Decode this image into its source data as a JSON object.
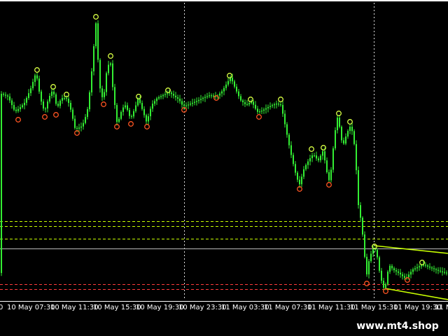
{
  "chart_data": {
    "type": "candlestick",
    "background_color": "#000000",
    "candle_color": "#33ee33",
    "fractal_up_color": "#d8ff44",
    "fractal_down_color": "#ff5522",
    "time_labels": [
      "10 May 07:30",
      "10 May 11:30",
      "10 May 15:30",
      "10 May 19:30",
      "10 May 23:30",
      "11 May 03:30",
      "11 May 07:30",
      "11 May 11:30",
      "11 May 15:30",
      "11 May 19:30"
    ],
    "partial_labels": {
      "left": "0",
      "right": "11 M"
    },
    "period_separator_labels": [
      "10 May 23:30"
    ],
    "horizontal_levels": [
      {
        "kind": "support-resistance",
        "color": "#c8ff00",
        "style": "dashed"
      },
      {
        "kind": "support-resistance",
        "color": "#c8ff00",
        "style": "dashed"
      },
      {
        "kind": "support-resistance",
        "color": "#c8ff00",
        "style": "dashed"
      },
      {
        "kind": "current-price",
        "color": "#bbbbbb",
        "style": "solid"
      },
      {
        "kind": "support-resistance",
        "color": "#ff3b3b",
        "style": "dashed"
      },
      {
        "kind": "support-resistance",
        "color": "#ff3b3b",
        "style": "dashed"
      }
    ],
    "fractals_up_count": 16,
    "fractals_down_count": 15
  },
  "watermark": {
    "text": "www.mt4.shop"
  }
}
